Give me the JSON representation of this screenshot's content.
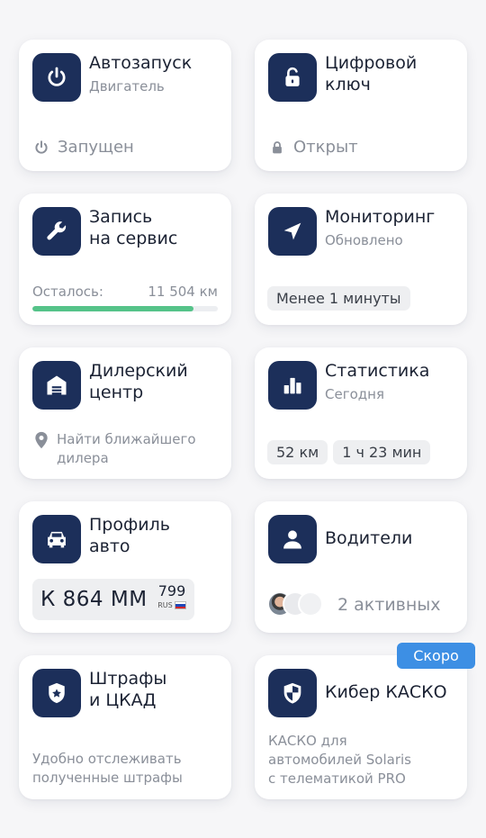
{
  "cards": {
    "autostart": {
      "title": "Автозапуск",
      "subtitle": "Двигатель",
      "status": "Запущен",
      "icon": "power-icon"
    },
    "digital_key": {
      "title": "Цифровой\nключ",
      "status": "Открыт",
      "icon": "unlock-icon"
    },
    "service": {
      "title": "Запись\nна сервис",
      "remaining_label": "Осталось:",
      "remaining_value": "11 504 км",
      "progress": 0.87,
      "icon": "wrench-icon"
    },
    "monitoring": {
      "title": "Мониторинг",
      "subtitle": "Обновлено",
      "chip": "Менее 1 минуты",
      "icon": "navigation-icon"
    },
    "dealer": {
      "title": "Дилерский\nцентр",
      "find_text": "Найти ближайшего\nдилера",
      "icon": "garage-icon"
    },
    "stats": {
      "title": "Статистика",
      "subtitle": "Сегодня",
      "distance": "52 км",
      "duration": "1 ч 23 мин",
      "icon": "bar-chart-icon"
    },
    "car_profile": {
      "title": "Профиль\nавто",
      "plate_number": "К 864 ММ",
      "plate_region": "799",
      "plate_country": "RUS",
      "icon": "car-icon"
    },
    "drivers": {
      "title": "Водители",
      "active_text": "2 активных",
      "icon": "person-icon"
    },
    "fines": {
      "title": "Штрафы\nи ЦКАД",
      "description": "Удобно отслеживать\nполученные штрафы",
      "icon": "badge-shield-icon"
    },
    "casco": {
      "title": "Кибер КАСКО",
      "description": "КАСКО для\nавтомобилей Solaris\nс телематикой PRO",
      "badge": "Скоро",
      "icon": "shield-icon"
    }
  },
  "colors": {
    "icon_bg": "#1c2f5a",
    "progress": "#55c389",
    "badge": "#3d8fe4",
    "muted_text": "#8a8f99"
  }
}
